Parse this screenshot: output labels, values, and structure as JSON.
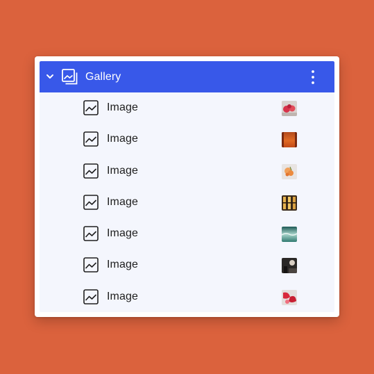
{
  "colors": {
    "background": "#db623d",
    "header": "#3858e9",
    "panel": "#ffffff",
    "list_bg": "#f4f6fd",
    "text": "#1e1e1e"
  },
  "gallery": {
    "title": "Gallery",
    "icon": "gallery-icon",
    "expanded": true
  },
  "items": [
    {
      "label": "Image",
      "icon": "image-icon",
      "thumbnail": "red-flowers-thumbnail"
    },
    {
      "label": "Image",
      "icon": "image-icon",
      "thumbnail": "orange-sunset-thumbnail"
    },
    {
      "label": "Image",
      "icon": "image-icon",
      "thumbnail": "orange-flower-thumbnail"
    },
    {
      "label": "Image",
      "icon": "image-icon",
      "thumbnail": "building-windows-thumbnail"
    },
    {
      "label": "Image",
      "icon": "image-icon",
      "thumbnail": "teal-wave-thumbnail"
    },
    {
      "label": "Image",
      "icon": "image-icon",
      "thumbnail": "dark-lamp-thumbnail"
    },
    {
      "label": "Image",
      "icon": "image-icon",
      "thumbnail": "red-petals-thumbnail"
    }
  ]
}
